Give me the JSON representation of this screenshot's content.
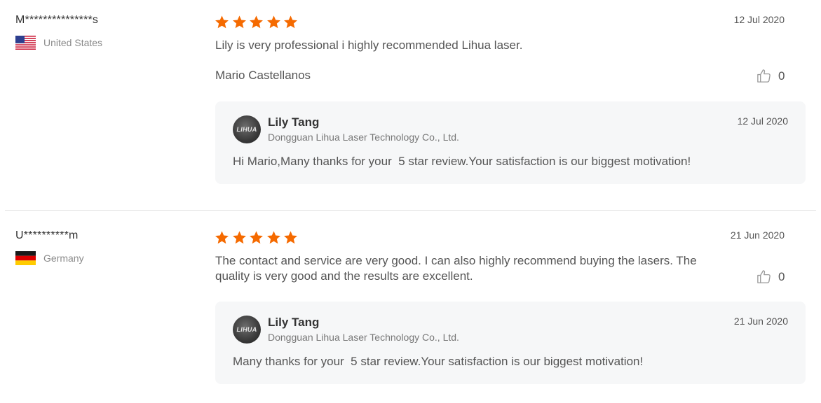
{
  "reviews": [
    {
      "user": "M***************s",
      "country": "United States",
      "flag_icon": "us-flag-icon",
      "rating": 5,
      "date": "12 Jul 2020",
      "text": "Lily is very professional i highly recommended Lihua laser.",
      "author": "Mario Castellanos",
      "likes": "0",
      "reply": {
        "avatar_text": "LIHUA",
        "name": "Lily Tang",
        "company": "Dongguan Lihua Laser Technology Co., Ltd.",
        "date": "12 Jul 2020",
        "text": "Hi Mario,Many thanks for your  5 star review.Your satisfaction is our biggest motivation!"
      }
    },
    {
      "user": "U**********m",
      "country": "Germany",
      "flag_icon": "germany-flag-icon",
      "rating": 5,
      "date": "21 Jun 2020",
      "text": "The contact and service are very good. I can also highly recommend buying the lasers. The quality is very good and the results are excellent.",
      "likes": "0",
      "reply": {
        "avatar_text": "LIHUA",
        "name": "Lily Tang",
        "company": "Dongguan Lihua Laser Technology Co., Ltd.",
        "date": "21 Jun 2020",
        "text": "Many thanks for your  5 star review.Your satisfaction is our biggest motivation!"
      }
    }
  ],
  "colors": {
    "star": "#f56a00",
    "reply_bg": "#f6f7f8",
    "divider": "#e3e3e3"
  }
}
